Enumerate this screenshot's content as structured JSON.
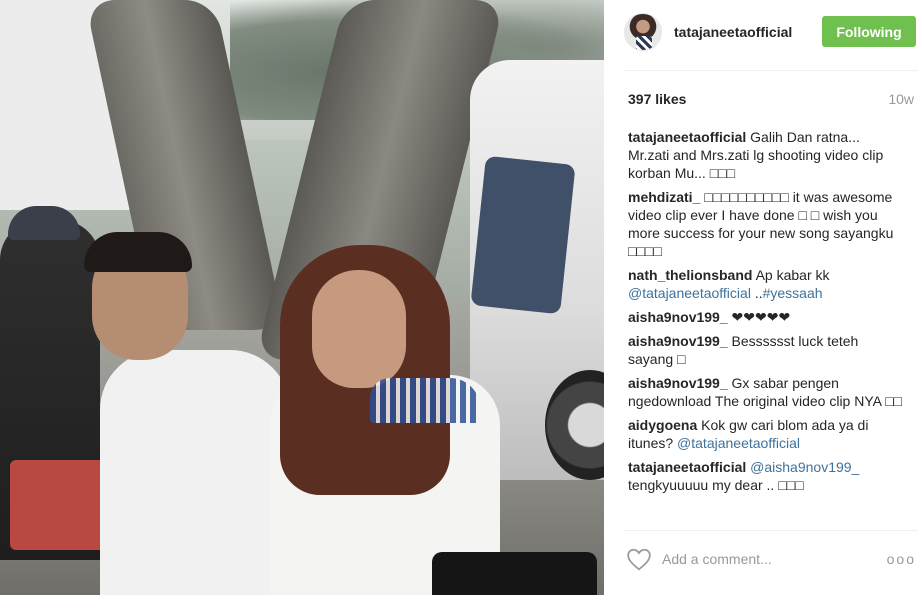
{
  "post": {
    "username": "tatajaneetaofficial",
    "follow_label": "Following",
    "likes": "397 likes",
    "time_ago": "10w",
    "comments": [
      {
        "author": "tatajaneetaofficial",
        "text": "Galih Dan ratna... Mr.zati and Mrs.zati lg shooting video clip korban Mu... □□□"
      },
      {
        "author": "mehdizati_",
        "text": "□□□□□□□□□□ it was awesome video clip ever I have done □ □ wish you more success for your new song sayangku □□□□"
      },
      {
        "author": "nath_thelionsband",
        "text": "Ap kabar kk",
        "mention": "@tatajaneetaofficial",
        "text_after": " ..",
        "hashtag": "#yessaah"
      },
      {
        "author": "aisha9nov199_",
        "text": "❤❤❤❤❤"
      },
      {
        "author": "aisha9nov199_",
        "text": "Besssssst luck teteh sayang □"
      },
      {
        "author": "aisha9nov199_",
        "text": "Gx sabar pengen ngedownload The original video clip NYA □□"
      },
      {
        "author": "aidygoena",
        "text": "Kok gw cari blom ada ya di itunes?",
        "mention": "@tatajaneetaofficial"
      },
      {
        "author": "tatajaneetaofficial",
        "mention_first": "@aisha9nov199_",
        "text": "tengkyuuuuu my dear .. □□□"
      }
    ],
    "comment_placeholder": "Add a comment...",
    "more_label": "ooo"
  },
  "icons": {
    "like": "heart-icon",
    "more": "more-options-icon",
    "avatar": "profile-avatar"
  },
  "colors": {
    "follow_button": "#70c050",
    "link": "#3f729b",
    "muted": "#999999"
  }
}
